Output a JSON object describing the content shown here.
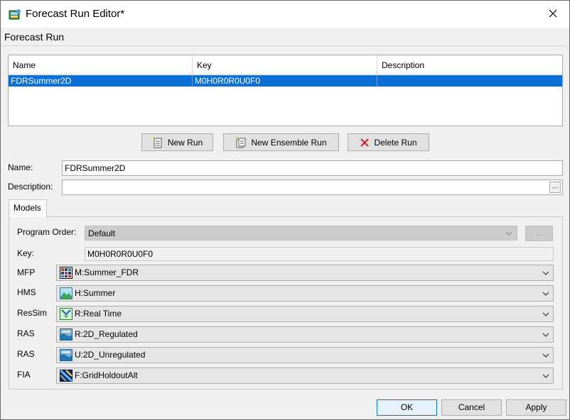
{
  "window": {
    "title": "Forecast Run Editor*"
  },
  "section": {
    "label": "Forecast Run"
  },
  "table": {
    "headers": [
      "Name",
      "Key",
      "Description"
    ],
    "rows": [
      {
        "name": "FDRSummer2D",
        "key": "M0H0R0R0U0F0",
        "description": ""
      }
    ]
  },
  "actions": {
    "new_run": "New Run",
    "new_ensemble_run": "New Ensemble Run",
    "delete_run": "Delete Run"
  },
  "form": {
    "name_label": "Name:",
    "name_value": "FDRSummer2D",
    "description_label": "Description:",
    "description_value": "",
    "description_more": "..."
  },
  "tabs": {
    "models": "Models"
  },
  "models": {
    "program_order_label": "Program Order:",
    "program_order_value": "Default",
    "program_order_more": "...",
    "key_label": "Key:",
    "key_value": "M0H0R0R0U0F0",
    "rows": [
      {
        "label": "MFP",
        "value": "M:Summer_FDR",
        "icon": "mfp-grid-icon"
      },
      {
        "label": "HMS",
        "value": "H:Summer",
        "icon": "hms-landscape-icon"
      },
      {
        "label": "ResSim",
        "value": "R:Real Time",
        "icon": "ressim-reservoir-icon"
      },
      {
        "label": "RAS",
        "value": "R:2D_Regulated",
        "icon": "ras-river-icon"
      },
      {
        "label": "RAS",
        "value": "U:2D_Unregulated",
        "icon": "ras-river-icon"
      },
      {
        "label": "FIA",
        "value": "F:GridHoldoutAlt",
        "icon": "fia-map-icon"
      }
    ]
  },
  "footer": {
    "ok": "OK",
    "cancel": "Cancel",
    "apply": "Apply"
  },
  "colors": {
    "selection": "#0a6fd6",
    "delete_x": "#d21e1e"
  }
}
